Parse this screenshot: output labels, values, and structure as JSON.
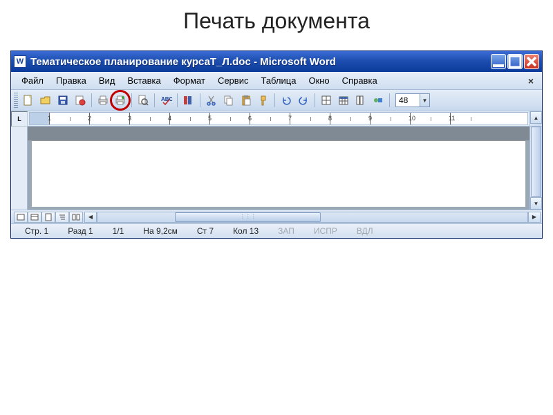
{
  "slide_title": "Печать документа",
  "window": {
    "title": "Тематическое планирование курсаТ_Л.doc - Microsoft Word",
    "app_icon_letter": "W"
  },
  "menubar": {
    "items": [
      {
        "label": "Файл",
        "u": "Ф"
      },
      {
        "label": "Правка",
        "u": "П"
      },
      {
        "label": "Вид",
        "u": "В"
      },
      {
        "label": "Вставка",
        "u": "а"
      },
      {
        "label": "Формат",
        "u": "м"
      },
      {
        "label": "Сервис",
        "u": "е"
      },
      {
        "label": "Таблица",
        "u": "Т"
      },
      {
        "label": "Окно",
        "u": "О"
      },
      {
        "label": "Справка",
        "u": "С"
      }
    ]
  },
  "toolbar": {
    "zoom_value": "48"
  },
  "ruler": {
    "corner": "L",
    "ticks": [
      "1",
      "2",
      "3",
      "4",
      "5",
      "6",
      "7",
      "8",
      "9",
      "10",
      "11"
    ]
  },
  "statusbar": {
    "page": "Стр. 1",
    "section": "Разд 1",
    "pages": "1/1",
    "at": "На 9,2см",
    "line": "Ст 7",
    "col": "Кол 13",
    "rec": "ЗАП",
    "trk": "ИСПР",
    "ext": "ВДЛ"
  }
}
